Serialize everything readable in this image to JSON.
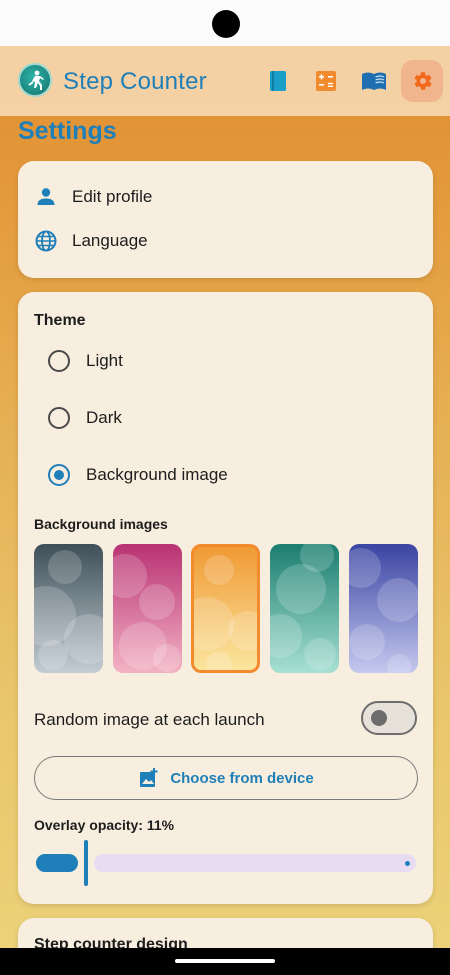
{
  "app": {
    "title": "Step Counter"
  },
  "appbar": {
    "actions": [
      {
        "name": "book-icon",
        "color": "#1aa0c8"
      },
      {
        "name": "calculator-icon",
        "color": "#f28a2e"
      },
      {
        "name": "open-book-icon",
        "color": "#1f6fb0"
      },
      {
        "name": "gear-icon",
        "color": "#f2691e",
        "active": true
      }
    ]
  },
  "page": {
    "title": "Settings"
  },
  "profile_card": {
    "items": [
      {
        "label": "Edit profile",
        "icon": "person-icon"
      },
      {
        "label": "Language",
        "icon": "globe-icon"
      }
    ]
  },
  "theme": {
    "title": "Theme",
    "options": [
      {
        "label": "Light",
        "checked": false
      },
      {
        "label": "Dark",
        "checked": false
      },
      {
        "label": "Background image",
        "checked": true
      }
    ],
    "background_images_title": "Background images",
    "thumbnails": [
      {
        "name": "slate",
        "from": "#3e4f58",
        "to": "#c3ccd4",
        "selected": false
      },
      {
        "name": "pink",
        "from": "#b83273",
        "to": "#f3b2c4",
        "selected": false
      },
      {
        "name": "orange",
        "from": "#f09a35",
        "to": "#fbe59e",
        "selected": true
      },
      {
        "name": "teal",
        "from": "#1b7e70",
        "to": "#a7e0d2",
        "selected": false
      },
      {
        "name": "indigo",
        "from": "#3a44a2",
        "to": "#c5c9ee",
        "selected": false
      }
    ],
    "random_label": "Random image at each launch",
    "random_enabled": false,
    "choose_button": "Choose from device",
    "overlay_label": "Overlay opacity: 11%",
    "overlay_value": 11
  },
  "next_section": {
    "title": "Step counter design"
  },
  "colors": {
    "accent": "#1f7fb8",
    "active_nav": "#f2691e"
  }
}
